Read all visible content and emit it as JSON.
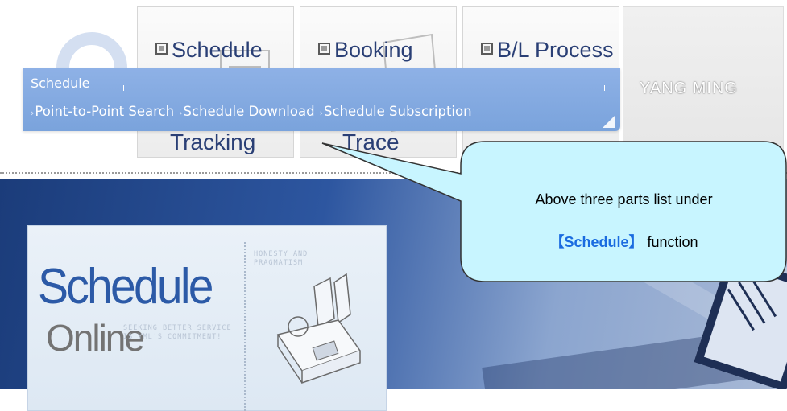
{
  "nav": {
    "tiles": [
      {
        "label": "Schedule",
        "sub": "Tracking"
      },
      {
        "label": "Booking",
        "sub": "Trace"
      },
      {
        "label": "B/L Process",
        "sub": ""
      }
    ],
    "logo": "YANG MING"
  },
  "submenu": {
    "title": "Schedule",
    "items": [
      "Point-to-Point Search",
      "Schedule Download",
      "Schedule Subscription"
    ]
  },
  "hero": {
    "schedule_word": "Schedule",
    "online_word": "Online",
    "tagline": "Seeking better service is YML's commitment!",
    "honesty": "Honesty and pragmatism"
  },
  "callout": {
    "line1": "Above three parts list under",
    "bracket_open": "【",
    "keyword": "Schedule",
    "bracket_close": "】",
    "suffix": " function"
  },
  "colors": {
    "submenu_bg": "#8eb1e6",
    "nav_text": "#2a3f75",
    "callout_fill": "#c8f5ff",
    "callout_keyword": "#1a6be0",
    "hero_blue": "#1b3c7a"
  }
}
